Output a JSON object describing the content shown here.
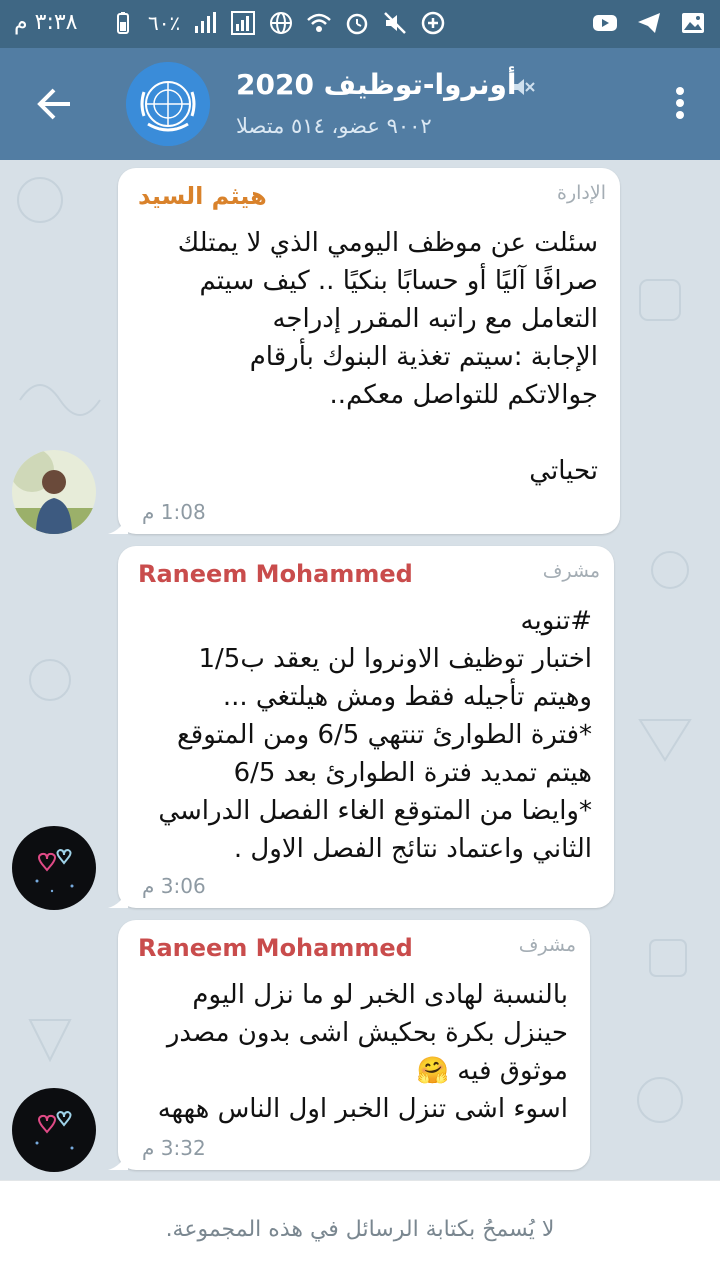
{
  "status_bar": {
    "time": "٣:٣٨ م",
    "battery_percent": "٦٠٪"
  },
  "header": {
    "title": "أونروا-توظيف 2020",
    "subtitle": "٩٠٠٢ عضو، ٥١٤ متصلا",
    "back_icon": "arrow-left-icon",
    "menu_icon": "more-vertical-icon",
    "muted_icon": "muted-speaker-icon"
  },
  "messages": [
    {
      "sender": "هيثم السيد",
      "sender_color": "#d9822b",
      "role": "الإدارة",
      "body": "سئلت عن موظف اليومي الذي لا يمتلك\nصرافًا آليًا أو حسابًا بنكيًا .. كيف سيتم\nالتعامل مع راتبه المقرر إدراجه\nالإجابة :سيتم تغذية البنوك بأرقام\nجوالاتكم للتواصل معكم..\n\nتحياتي",
      "time": "1:08 م"
    },
    {
      "sender": "Raneem Mohammed",
      "sender_color": "#c94c4c",
      "role": "مشرف",
      "hashtag": "#تنويه",
      "body": "اختبار توظيف الاونروا لن يعقد ب1/5\nوهيتم تأجيله فقط ومش هيلتغي ...\n*فترة الطوارئ تنتهي 6/5 ومن المتوقع\nهيتم تمديد فترة الطوارئ بعد 6/5\n*وايضا من المتوقع الغاء الفصل الدراسي\nالثاني واعتماد نتائج الفصل الاول .",
      "time": "3:06 م"
    },
    {
      "sender": "Raneem Mohammed",
      "sender_color": "#c94c4c",
      "role": "مشرف",
      "body": "بالنسبة لهادى الخبر لو ما نزل اليوم\nحينزل بكرة بحكيش اشى بدون مصدر\nموثوق فيه 🤗\nاسوء اشى تنزل الخبر اول الناس هههه",
      "time": "3:32 م"
    }
  ],
  "composer": {
    "notice": "لا يُسمحُ بكتابة الرسائل في هذه المجموعة."
  },
  "colors": {
    "status_bar": "#3f6784",
    "header": "#527da3",
    "chat_background": "#d7e0e7",
    "hashtag": "#2a7ac0"
  }
}
